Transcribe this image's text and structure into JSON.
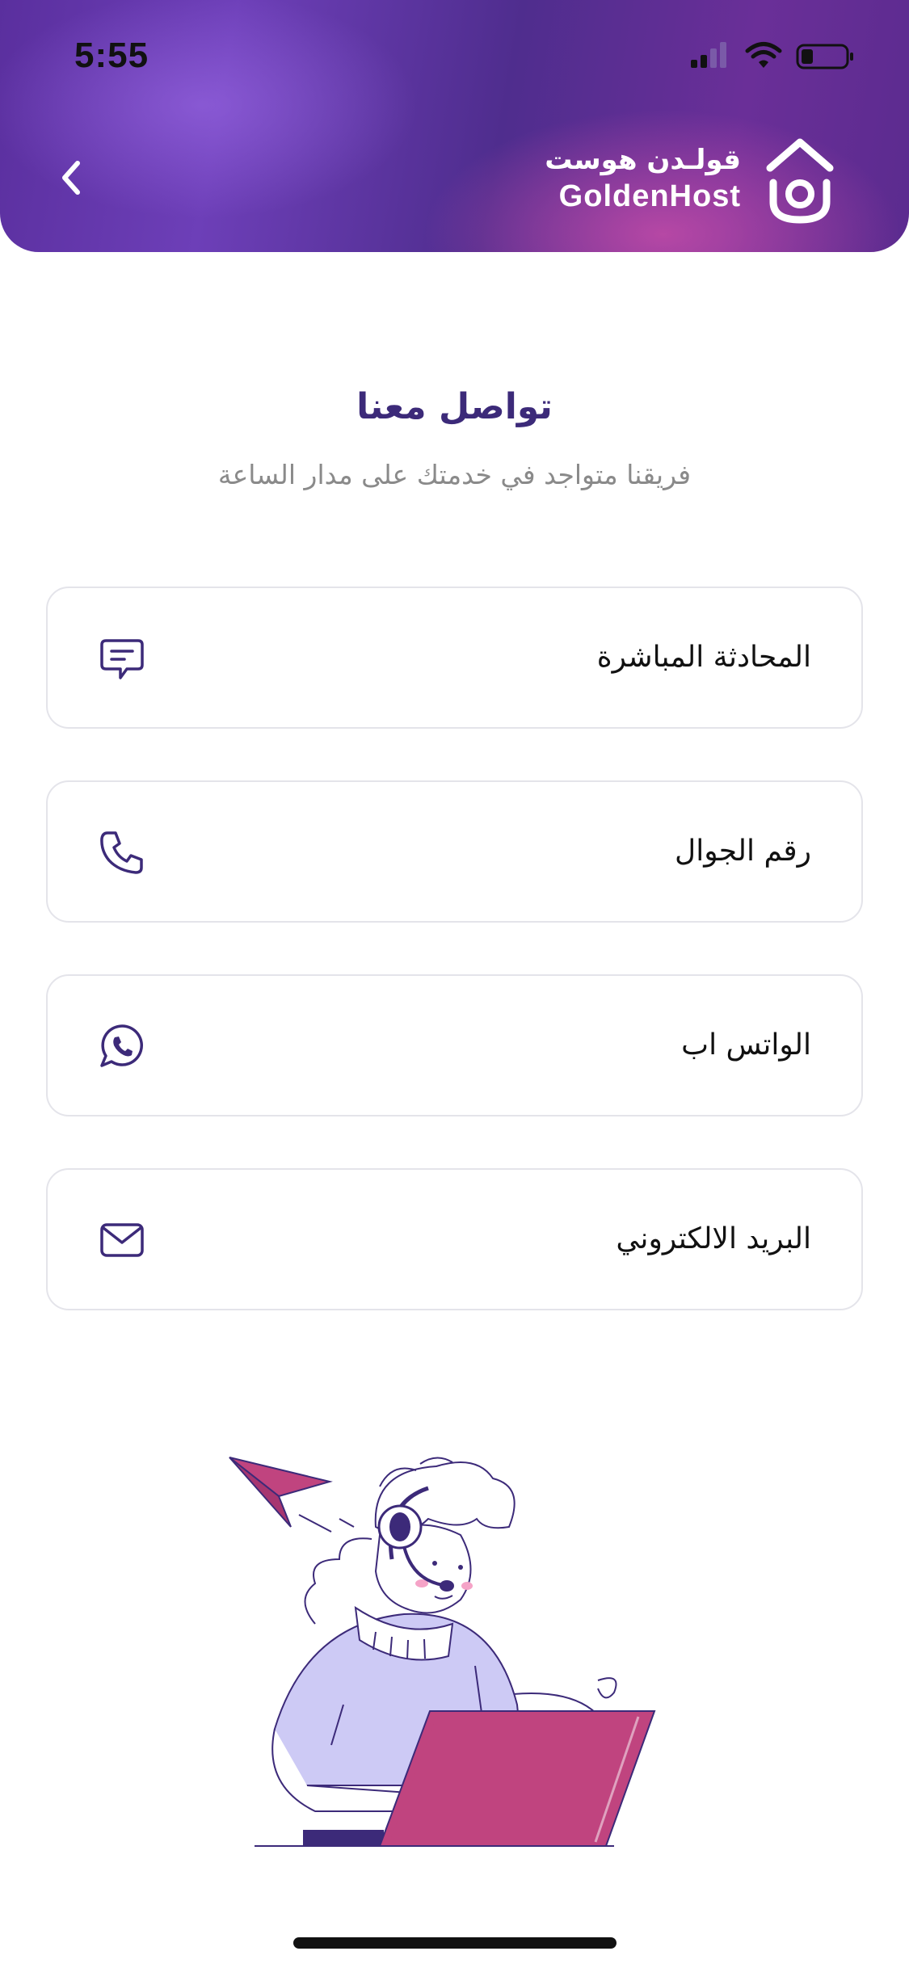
{
  "status_bar": {
    "time": "5:55"
  },
  "header": {
    "brand_ar": "قولـدن هوست",
    "brand_en": "GoldenHost"
  },
  "page": {
    "title": "تواصل معنا",
    "subtitle": "فريقنا متواجد في خدمتك على مدار الساعة"
  },
  "contact_options": [
    {
      "label": "المحادثة المباشرة",
      "icon": "chat-icon"
    },
    {
      "label": "رقم الجوال",
      "icon": "phone-icon"
    },
    {
      "label": "الواتس اب",
      "icon": "whatsapp-icon"
    },
    {
      "label": "البريد الالكتروني",
      "icon": "mail-icon"
    }
  ],
  "colors": {
    "accent": "#3c2a79",
    "header_purple": "#5a2f9e",
    "header_pink": "#d250aa",
    "laptop": "#c0447f",
    "shirt": "#cdcaf5"
  }
}
